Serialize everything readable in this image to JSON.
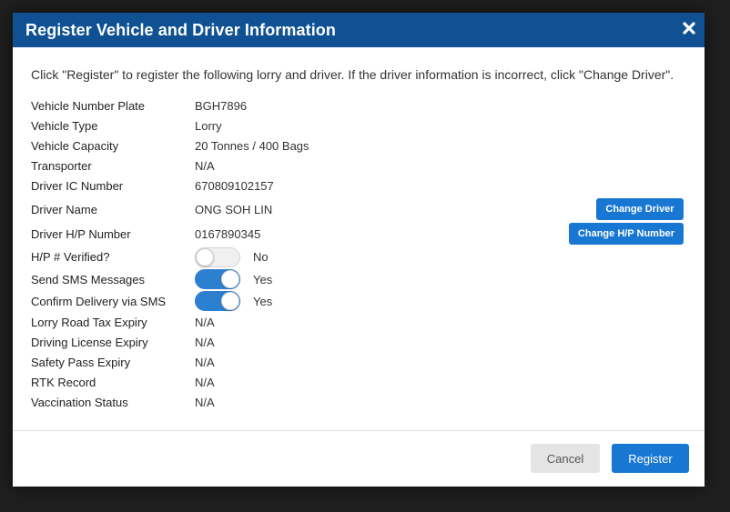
{
  "dialog": {
    "title": "Register Vehicle and Driver Information",
    "close_icon": "close-icon",
    "instructions": "Click \"Register\" to register the following lorry and driver.  If the driver information is incorrect, click \"Change Driver\"."
  },
  "fields": {
    "vehicle_number_plate": {
      "label": "Vehicle Number Plate",
      "value": "BGH7896"
    },
    "vehicle_type": {
      "label": "Vehicle Type",
      "value": "Lorry"
    },
    "vehicle_capacity": {
      "label": "Vehicle Capacity",
      "value": "20 Tonnes / 400 Bags"
    },
    "transporter": {
      "label": "Transporter",
      "value": "N/A"
    },
    "driver_ic": {
      "label": "Driver IC Number",
      "value": "670809102157"
    },
    "driver_name": {
      "label": "Driver Name",
      "value": "ONG SOH LIN"
    },
    "driver_hp": {
      "label": "Driver H/P Number",
      "value": "0167890345"
    },
    "hp_verified": {
      "label": "H/P # Verified?",
      "state": "No",
      "on": false
    },
    "send_sms": {
      "label": "Send SMS Messages",
      "state": "Yes",
      "on": true
    },
    "confirm_sms": {
      "label": "Confirm Delivery via SMS",
      "state": "Yes",
      "on": true
    },
    "road_tax": {
      "label": "Lorry Road Tax Expiry",
      "value": "N/A"
    },
    "driving_license": {
      "label": "Driving License Expiry",
      "value": "N/A"
    },
    "safety_pass": {
      "label": "Safety Pass Expiry",
      "value": "N/A"
    },
    "rtk_record": {
      "label": "RTK Record",
      "value": "N/A"
    },
    "vaccination": {
      "label": "Vaccination Status",
      "value": "N/A"
    }
  },
  "buttons": {
    "change_driver": "Change Driver",
    "change_hp": "Change H/P Number",
    "cancel": "Cancel",
    "register": "Register"
  },
  "colors": {
    "header": "#0f5192",
    "primary": "#1877d2",
    "toggle_on": "#2d7fd0",
    "cancel_bg": "#e4e4e4"
  }
}
